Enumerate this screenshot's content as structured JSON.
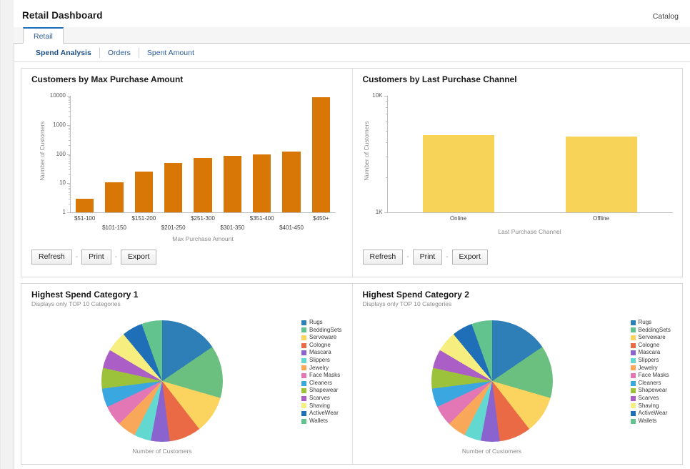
{
  "header": {
    "title": "Retail Dashboard",
    "catalog_label": "Catalog"
  },
  "tabs": {
    "main_tab": "Retail",
    "sub_tabs": [
      {
        "label": "Spend Analysis",
        "active": true
      },
      {
        "label": "Orders",
        "active": false
      },
      {
        "label": "Spent Amount",
        "active": false
      }
    ]
  },
  "actions": {
    "refresh_label": "Refresh",
    "print_label": "Print",
    "export_label": "Export",
    "separator": "-"
  },
  "panels": {
    "spend_category_1": {
      "title": "Highest Spend Category 1",
      "subtitle": "Displays only TOP 10 Categories"
    },
    "spend_category_2": {
      "title": "Highest Spend Category 2",
      "subtitle": "Displays only TOP 10 Categories"
    }
  },
  "colors": {
    "bar_orange": "#d97706",
    "bar_yellow": "#f7d358",
    "tab_accent": "#1f6fb8",
    "link": "#2a5b94"
  },
  "chart_data": [
    {
      "id": "customers-by-max-purchase-amount",
      "type": "bar",
      "title": "Customers by Max Purchase Amount",
      "xlabel": "Max Purchase Amount",
      "ylabel": "Number of Customers",
      "yscale": "log",
      "ylim": [
        1,
        10000
      ],
      "ytick_labels": [
        "1",
        "10",
        "100",
        "1000",
        "10000"
      ],
      "ytick_values": [
        1,
        10,
        100,
        1000,
        10000
      ],
      "grid": false,
      "bar_color": "#d97706",
      "categories": [
        "$51-100",
        "$101-150",
        "$151-200",
        "$201-250",
        "$251-300",
        "$301-350",
        "$351-400",
        "$401-450",
        "$450+"
      ],
      "values": [
        3,
        11,
        25,
        48,
        72,
        85,
        100,
        119,
        8700
      ]
    },
    {
      "id": "customers-by-last-purchase-channel",
      "type": "bar",
      "title": "Customers by Last Purchase Channel",
      "xlabel": "Last Purchase Channel",
      "ylabel": "Number of Customers",
      "yscale": "log",
      "ylim": [
        1000,
        10000
      ],
      "ytick_labels": [
        "1K",
        "10K"
      ],
      "ytick_values": [
        1000,
        10000
      ],
      "grid": false,
      "bar_color": "#f7d358",
      "categories": [
        "Online",
        "Offline"
      ],
      "values": [
        4600,
        4500
      ]
    },
    {
      "id": "highest-spend-category-1",
      "type": "pie",
      "title": "Highest Spend Category 1",
      "subtitle": "Displays only TOP 10 Categories",
      "caption": "Number of Customers",
      "legend_position": "right",
      "labels": [
        "Rugs",
        "BeddingSets",
        "Serveware",
        "Cologne",
        "Mascara",
        "Slippers",
        "Jewelry",
        "Face Masks",
        "Cleaners",
        "Shapewear",
        "Scarves",
        "Shaving",
        "ActiveWear",
        "Wallets"
      ],
      "values": [
        15.5,
        14.0,
        10.0,
        8.5,
        5.0,
        4.5,
        5.0,
        5.5,
        5.0,
        5.5,
        5.0,
        5.5,
        5.5,
        5.5
      ],
      "slice_colors": [
        "#2e7eb8",
        "#6cc07f",
        "#fbd35f",
        "#ea6a46",
        "#8b63cf",
        "#63d8d1",
        "#f9a85a",
        "#e377b5",
        "#3ba7e0",
        "#9cc13b",
        "#ab5fc6",
        "#f6ef7f",
        "#1f6fb8",
        "#63c38e"
      ]
    },
    {
      "id": "highest-spend-category-2",
      "type": "pie",
      "title": "Highest Spend Category 2",
      "subtitle": "Displays only TOP 10 Categories",
      "caption": "Number of Customers",
      "legend_position": "right",
      "labels": [
        "Rugs",
        "BeddingSets",
        "Serveware",
        "Cologne",
        "Mascara",
        "Slippers",
        "Jewelry",
        "Face Masks",
        "Cleaners",
        "Shapewear",
        "Scarves",
        "Shaving",
        "ActiveWear",
        "Wallets"
      ],
      "values": [
        15.5,
        14.0,
        10.0,
        8.5,
        5.0,
        4.5,
        5.0,
        5.5,
        5.0,
        5.5,
        5.0,
        5.5,
        5.5,
        5.5
      ],
      "slice_colors": [
        "#2e7eb8",
        "#6cc07f",
        "#fbd35f",
        "#ea6a46",
        "#8b63cf",
        "#63d8d1",
        "#f9a85a",
        "#e377b5",
        "#3ba7e0",
        "#9cc13b",
        "#ab5fc6",
        "#f6ef7f",
        "#1f6fb8",
        "#63c38e"
      ]
    }
  ],
  "legend": {
    "entries": [
      {
        "label": "Rugs",
        "color": "#2e7eb8"
      },
      {
        "label": "BeddingSets",
        "color": "#63c38e"
      },
      {
        "label": "Serveware",
        "color": "#fbd35f"
      },
      {
        "label": "Cologne",
        "color": "#ea6a46"
      },
      {
        "label": "Mascara",
        "color": "#8b63cf"
      },
      {
        "label": "Slippers",
        "color": "#63d8d1"
      },
      {
        "label": "Jewelry",
        "color": "#f9a85a"
      },
      {
        "label": "Face Masks",
        "color": "#e377b5"
      },
      {
        "label": "Cleaners",
        "color": "#3ba7e0"
      },
      {
        "label": "Shapewear",
        "color": "#9cc13b"
      },
      {
        "label": "Scarves",
        "color": "#ab5fc6"
      },
      {
        "label": "Shaving",
        "color": "#f6ef7f"
      },
      {
        "label": "ActiveWear",
        "color": "#1f6fb8"
      },
      {
        "label": "Wallets",
        "color": "#63c38e"
      }
    ]
  }
}
